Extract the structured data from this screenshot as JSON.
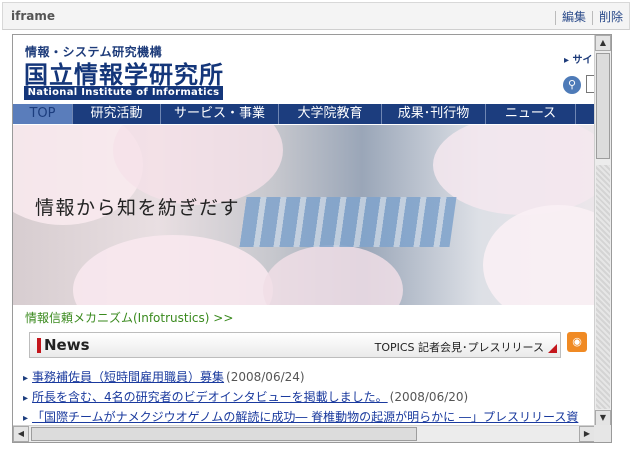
{
  "widget": {
    "title": "iframe",
    "edit_label": "編集",
    "delete_label": "削除"
  },
  "site": {
    "org_small": "情報・システム研究機構",
    "org_name": "国立情報学研究所",
    "org_name_en": "National Institute of Informatics",
    "site_link": "サイ",
    "search_value": ""
  },
  "nav": {
    "tabs": [
      {
        "label": "TOP",
        "active": true
      },
      {
        "label": "研究活動"
      },
      {
        "label": "サービス・事業"
      },
      {
        "label": "大学院教育"
      },
      {
        "label": "成果･刊行物"
      },
      {
        "label": "ニュース"
      }
    ]
  },
  "hero": {
    "tagline": "情報から知を紡ぎだす"
  },
  "infotrustics_link": "情報信頼メカニズム(Infotrustics) >>",
  "news": {
    "label": "News",
    "topics_link": "TOPICS 記者会見･プレスリリース",
    "items": [
      {
        "title": "事務補佐員（短時間雇用職員）募集",
        "date": "(2008/06/24)"
      },
      {
        "title": "所長を含む、4名の研究者のビデオインタビューを掲載しました。",
        "date": "(2008/06/20)"
      },
      {
        "title": "「国際チームがナメクジウオゲノムの解読に成功― 脊椎動物の起源が明らかに ―」プレスリリース資",
        "date": ""
      }
    ]
  },
  "colors": {
    "brand_navy": "#1c3d7e",
    "link_blue": "#1a3a9e",
    "link_green": "#3a8a1e",
    "accent_red": "#c4161c",
    "rss_orange": "#f08a24"
  },
  "icons": [
    "search-icon",
    "rss-icon",
    "chevron-right-icon",
    "arrow-up-icon",
    "arrow-down-icon",
    "arrow-left-icon",
    "arrow-right-icon"
  ]
}
